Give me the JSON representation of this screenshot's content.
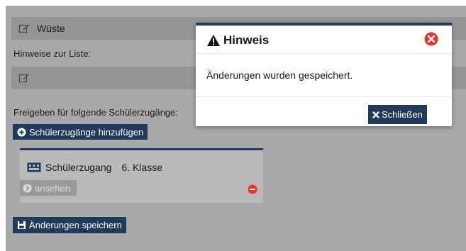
{
  "form": {
    "list_name": "Wüste",
    "notes_label": "Hinweise zur Liste:",
    "share_label": "Freigeben für folgende Schülerzugänge:",
    "add_access_label": "Schülerzugänge hinzufügen",
    "save_label": "Änderungen speichern"
  },
  "access_card": {
    "title": "Schülerzugang",
    "grade": "6. Klasse",
    "view_label": "ansehen"
  },
  "modal": {
    "title": "Hinweis",
    "message": "Änderungen wurden gespeichert.",
    "close_label": "Schließen"
  },
  "colors": {
    "accent": "#1f3a5a",
    "danger": "#e8322a",
    "backdrop": "#a9a9a9"
  },
  "icons": {
    "edit": "edit-icon",
    "add": "plus-circle-icon",
    "save": "floppy-disk-icon",
    "access": "keyboard-icon",
    "view": "chevron-circle-right-icon",
    "remove": "minus-circle-icon",
    "warning": "warning-triangle-icon",
    "close": "close-circle-icon"
  }
}
